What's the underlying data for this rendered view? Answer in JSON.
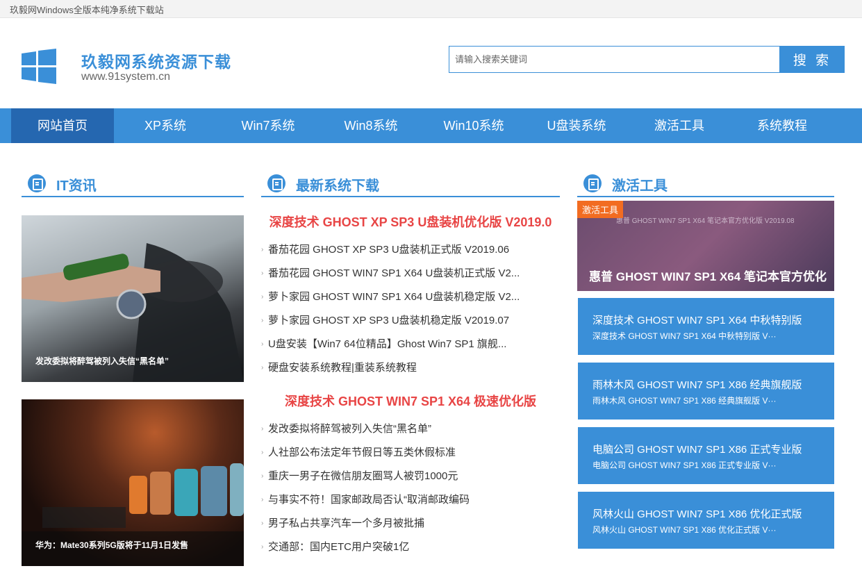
{
  "topbar": {
    "text": "玖毅网Windows全版本纯净系统下载站"
  },
  "header": {
    "site_name": "玖毅网系统资源下载",
    "site_url": "www.91system.cn",
    "search_placeholder": "请输入搜索关键词",
    "search_button": "搜 索"
  },
  "nav": {
    "items": [
      {
        "label": "网站首页",
        "active": true
      },
      {
        "label": "XP系统"
      },
      {
        "label": "Win7系统"
      },
      {
        "label": "Win8系统"
      },
      {
        "label": "Win10系统"
      },
      {
        "label": "U盘装系统"
      },
      {
        "label": "激活工具"
      },
      {
        "label": "系统教程"
      }
    ]
  },
  "it_news": {
    "title": "IT资讯",
    "items": [
      {
        "caption": "发改委拟将醉驾被列入失信“黑名单”"
      },
      {
        "caption": "华为：Mate30系列5G版将于11月1日发售"
      }
    ]
  },
  "downloads": {
    "title": "最新系统下载",
    "group1": {
      "featured": "深度技术 GHOST XP SP3 U盘装机优化版 V2019.0",
      "items": [
        "番茄花园 GHOST XP SP3 U盘装机正式版 V2019.06",
        "番茄花园 GHOST WIN7 SP1 X64 U盘装机正式版 V2...",
        "萝卜家园 GHOST WIN7 SP1 X64 U盘装机稳定版 V2...",
        "萝卜家园 GHOST XP SP3 U盘装机稳定版 V2019.07",
        "U盘安装【Win7 64位精品】Ghost Win7 SP1 旗舰...",
        "硬盘安装系统教程|重装系统教程"
      ]
    },
    "group2": {
      "featured": "深度技术 GHOST WIN7 SP1 X64 极速优化版",
      "items": [
        "发改委拟将醉驾被列入失信“黑名单”",
        "人社部公布法定年节假日等五类休假标准",
        "重庆一男子在微信朋友圈骂人被罚1000元",
        "与事实不符！国家邮政局否认“取消邮政编码",
        "男子私占共享汽车一个多月被批捕",
        "交通部：国内ETC用户突破1亿"
      ]
    }
  },
  "activation": {
    "title": "激活工具",
    "banner": {
      "tag": "激活工具",
      "caption": "惠普 GHOST WIN7 SP1 X64 笔记本官方优化",
      "image_text": "惠普 GHOST WIN7 SP1 X64 笔记本官方优化版 V2019.08"
    },
    "cards": [
      {
        "title": "深度技术 GHOST WIN7 SP1 X64 中秋特别版",
        "subtitle": "深度技术 GHOST WIN7 SP1 X64 中秋特别版 V···"
      },
      {
        "title": "雨林木风 GHOST WIN7 SP1 X86 经典旗舰版",
        "subtitle": "雨林木风 GHOST WIN7 SP1 X86 经典旗舰版 V···"
      },
      {
        "title": "电脑公司 GHOST WIN7 SP1 X86 正式专业版",
        "subtitle": "电脑公司 GHOST WIN7 SP1 X86 正式专业版 V···"
      },
      {
        "title": "风林火山 GHOST WIN7 SP1 X86 优化正式版",
        "subtitle": "风林火山 GHOST WIN7 SP1 X86 优化正式版 V···"
      }
    ]
  },
  "colors": {
    "accent": "#3a8fd8",
    "nav_active": "#2567b0",
    "featured": "#e84545",
    "tag": "#f26c21"
  }
}
